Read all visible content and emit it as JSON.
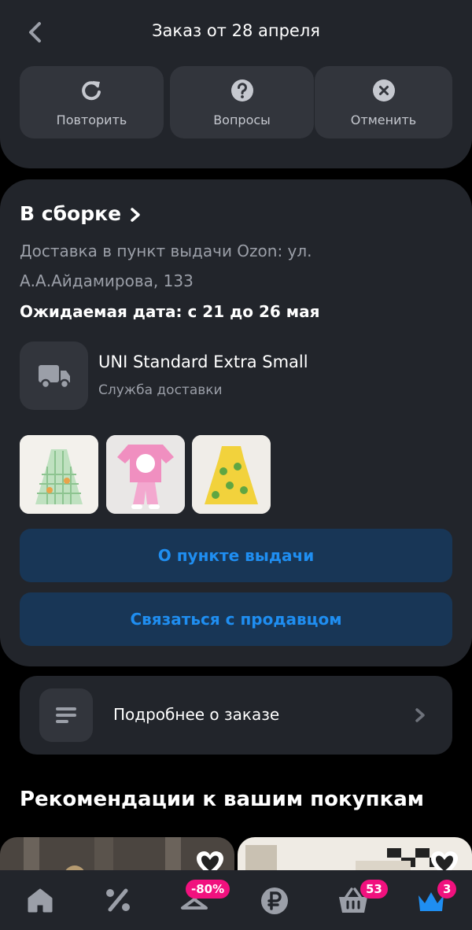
{
  "header": {
    "title": "Заказ от 28 апреля",
    "actions": [
      {
        "label": "Повторить",
        "icon": "repeat-icon"
      },
      {
        "label": "Вопросы",
        "icon": "question-icon"
      },
      {
        "label": "Отменить",
        "icon": "cancel-icon"
      }
    ]
  },
  "shipment": {
    "status": "В сборке",
    "address": "Доставка в пункт выдачи Ozon: ул. А.А.Айдамирова, 133",
    "eta": "Ожидаемая дата: с 21 до 26 мая",
    "carrier_name": "UNI Standard Extra Small",
    "carrier_sub": "Служба доставки",
    "products": [
      {
        "icon": "green-plaid-dress-image"
      },
      {
        "icon": "pink-bunny-outfit-image"
      },
      {
        "icon": "yellow-lemon-dress-image"
      }
    ],
    "pickup_button": "О пункте выдачи",
    "contact_button": "Связаться с продавцом"
  },
  "details": {
    "label": "Подробнее о заказе"
  },
  "recommendations": {
    "title": "Рекомендации к вашим покупкам"
  },
  "tabbar": {
    "tabs": [
      {
        "icon": "home-icon",
        "badge": ""
      },
      {
        "icon": "percent-icon",
        "badge": ""
      },
      {
        "icon": "hanger-icon",
        "badge": "-80%"
      },
      {
        "icon": "ruble-icon",
        "badge": ""
      },
      {
        "icon": "cart-icon",
        "badge": "53"
      },
      {
        "icon": "crown-icon",
        "badge": "3"
      }
    ]
  },
  "colors": {
    "accent": "#1f8ef1",
    "badge": "#f1117e",
    "card": "#22252b"
  }
}
